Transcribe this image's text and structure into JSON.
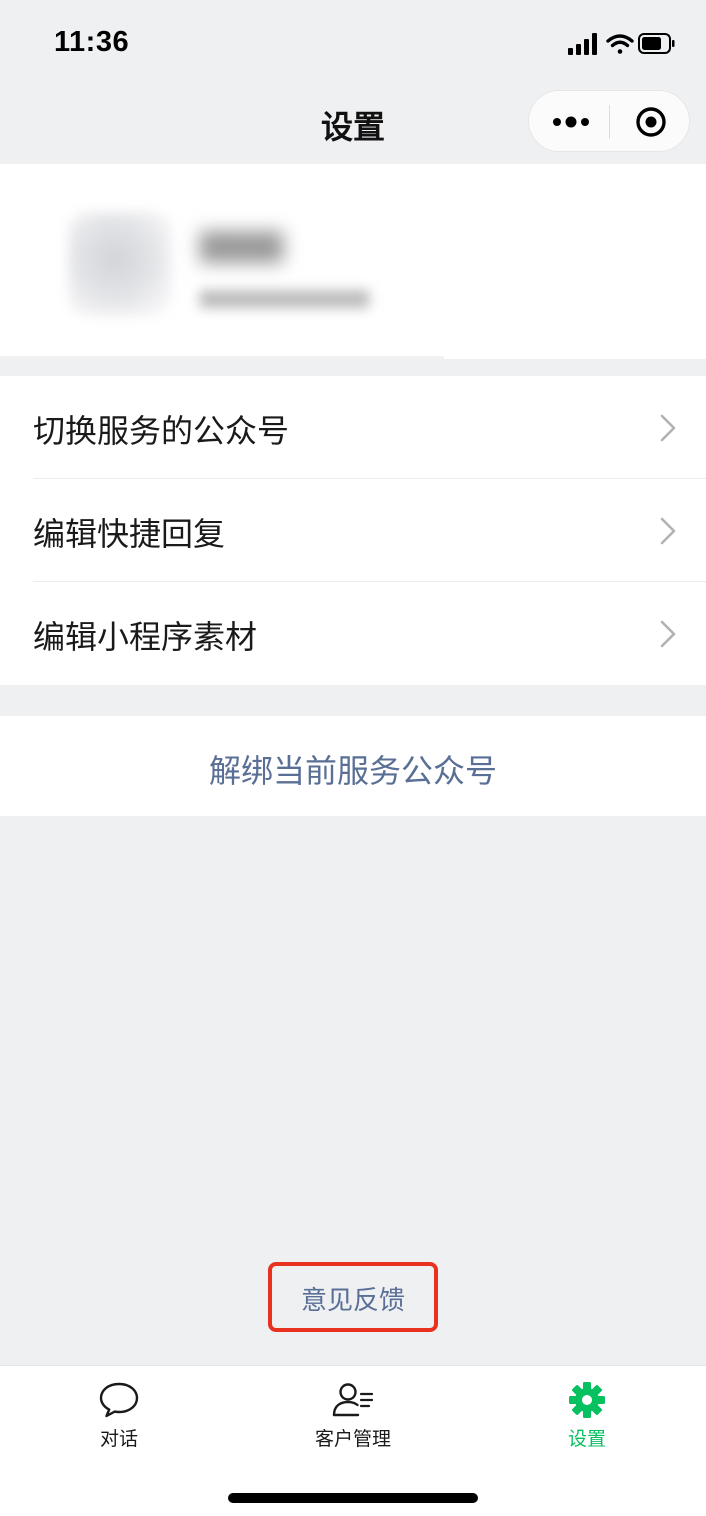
{
  "status_bar": {
    "time": "11:36",
    "icons": [
      "signal-icon",
      "wifi-icon",
      "battery-icon"
    ]
  },
  "nav": {
    "title": "设置",
    "capsule_icons": [
      "more-icon",
      "close-miniprogram-icon"
    ]
  },
  "menu": {
    "items": [
      {
        "label": "切换服务的公众号"
      },
      {
        "label": "编辑快捷回复"
      },
      {
        "label": "编辑小程序素材"
      }
    ]
  },
  "unbind_label": "解绑当前服务公众号",
  "feedback_label": "意见反馈",
  "tabbar": {
    "active_color": "#07c160",
    "tabs": [
      {
        "label": "对话",
        "icon": "chat-bubble-icon"
      },
      {
        "label": "客户管理",
        "icon": "customer-list-icon"
      },
      {
        "label": "设置",
        "icon": "gear-icon"
      }
    ]
  },
  "colors": {
    "link": "#5a6f96",
    "highlight_border": "#e8311f",
    "background": "#eff0f2"
  }
}
